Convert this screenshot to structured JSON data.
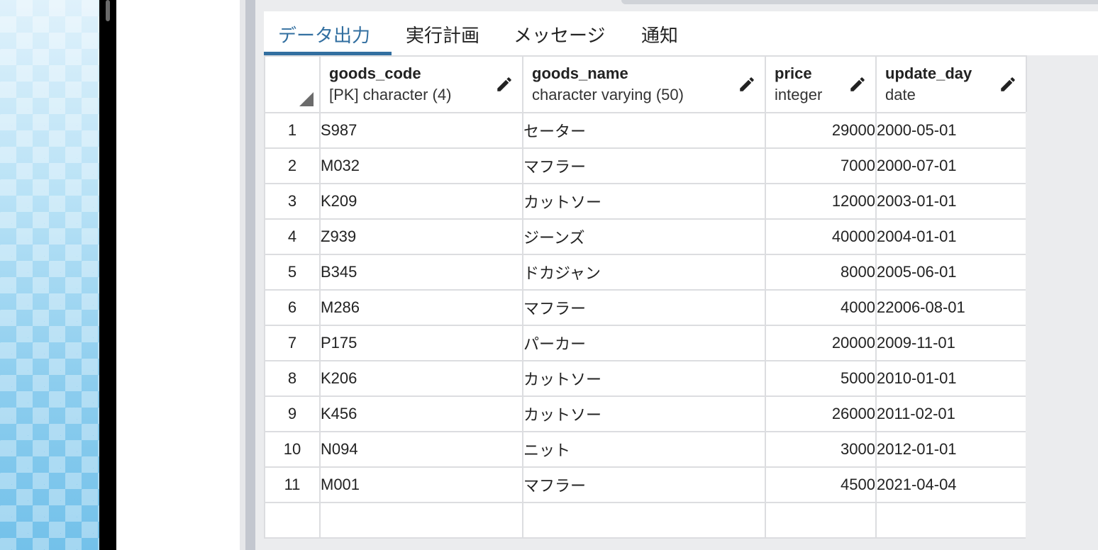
{
  "tabs": [
    {
      "label": "データ出力",
      "active": true
    },
    {
      "label": "実行計画",
      "active": false
    },
    {
      "label": "メッセージ",
      "active": false
    },
    {
      "label": "通知",
      "active": false
    }
  ],
  "columns": [
    {
      "name": "goods_code",
      "type": "[PK] character (4)"
    },
    {
      "name": "goods_name",
      "type": "character varying (50)"
    },
    {
      "name": "price",
      "type": "integer"
    },
    {
      "name": "update_day",
      "type": "date"
    }
  ],
  "rows": [
    {
      "n": "1",
      "goods_code": "S987",
      "goods_name": "セーター",
      "price": "29000",
      "update_day": "2000-05-01"
    },
    {
      "n": "2",
      "goods_code": "M032",
      "goods_name": "マフラー",
      "price": "7000",
      "update_day": "2000-07-01"
    },
    {
      "n": "3",
      "goods_code": "K209",
      "goods_name": "カットソー",
      "price": "12000",
      "update_day": "2003-01-01"
    },
    {
      "n": "4",
      "goods_code": "Z939",
      "goods_name": "ジーンズ",
      "price": "40000",
      "update_day": "2004-01-01"
    },
    {
      "n": "5",
      "goods_code": "B345",
      "goods_name": "ドカジャン",
      "price": "8000",
      "update_day": "2005-06-01"
    },
    {
      "n": "6",
      "goods_code": "M286",
      "goods_name": "マフラー",
      "price": "4000",
      "update_day": "22006-08-01"
    },
    {
      "n": "7",
      "goods_code": "P175",
      "goods_name": "パーカー",
      "price": "20000",
      "update_day": "2009-11-01"
    },
    {
      "n": "8",
      "goods_code": "K206",
      "goods_name": "カットソー",
      "price": "5000",
      "update_day": "2010-01-01"
    },
    {
      "n": "9",
      "goods_code": "K456",
      "goods_name": "カットソー",
      "price": "26000",
      "update_day": "2011-02-01"
    },
    {
      "n": "10",
      "goods_code": "N094",
      "goods_name": "ニット",
      "price": "3000",
      "update_day": "2012-01-01"
    },
    {
      "n": "11",
      "goods_code": "M001",
      "goods_name": "マフラー",
      "price": "4500",
      "update_day": "2021-04-04"
    }
  ],
  "colors": {
    "active_tab": "#326fa0",
    "grid_border": "#dcdde0",
    "panel_bg": "#ebecee"
  },
  "icons": {
    "column_edit": "pencil-icon",
    "select_all": "corner-triangle-icon"
  }
}
